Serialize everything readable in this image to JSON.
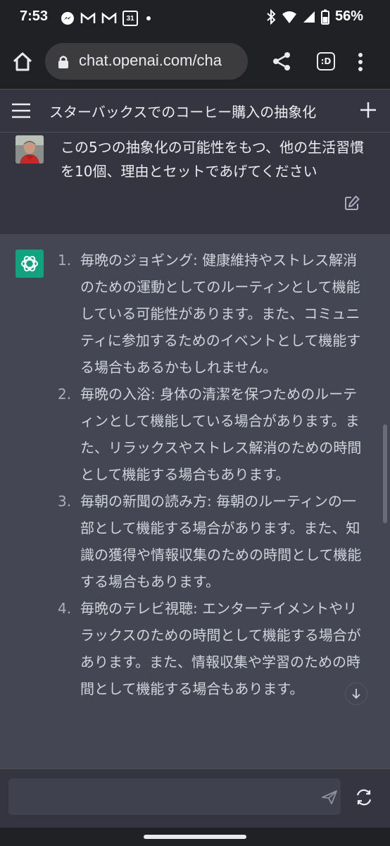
{
  "status": {
    "time": "7:53",
    "calendar_date": "31",
    "battery": "56%",
    "left_icons": [
      "messenger-icon",
      "gmail-icon",
      "gmail-icon",
      "calendar-icon",
      "dot-icon"
    ],
    "right_icons": [
      "bluetooth-icon",
      "wifi-icon",
      "signal-icon",
      "battery-icon"
    ]
  },
  "browser": {
    "url": "chat.openai.com/cha",
    "tab_label": ":D"
  },
  "header": {
    "title": "スターバックスでのコーヒー購入の抽象化"
  },
  "user_message": {
    "text": "この5つの抽象化の可能性をもつ、他の生活習慣を10個、理由とセットであげてください"
  },
  "assistant_message": {
    "items": [
      {
        "num": "1.",
        "text": "毎晩のジョギング: 健康維持やストレス解消のための運動としてのルーティンとして機能している可能性があります。また、コミュニティに参加するためのイベントとして機能する場合もあるかもしれません。"
      },
      {
        "num": "2.",
        "text": "毎晩の入浴: 身体の清潔を保つためのルーティンとして機能している場合があります。また、リラックスやストレス解消のための時間として機能する場合もあります。"
      },
      {
        "num": "3.",
        "text": "毎朝の新聞の読み方: 毎朝のルーティンの一部として機能する場合があります。また、知識の獲得や情報収集のための時間として機能する場合もあります。"
      },
      {
        "num": "4.",
        "text": "毎晩のテレビ視聴: エンターテイメントやリラックスのための時間として機能する場合があります。また、情報収集や学習のための時間として機能する場合もあります。"
      }
    ]
  },
  "colors": {
    "accent": "#10a37f",
    "background": "#343541",
    "assistant_background": "#444654"
  }
}
